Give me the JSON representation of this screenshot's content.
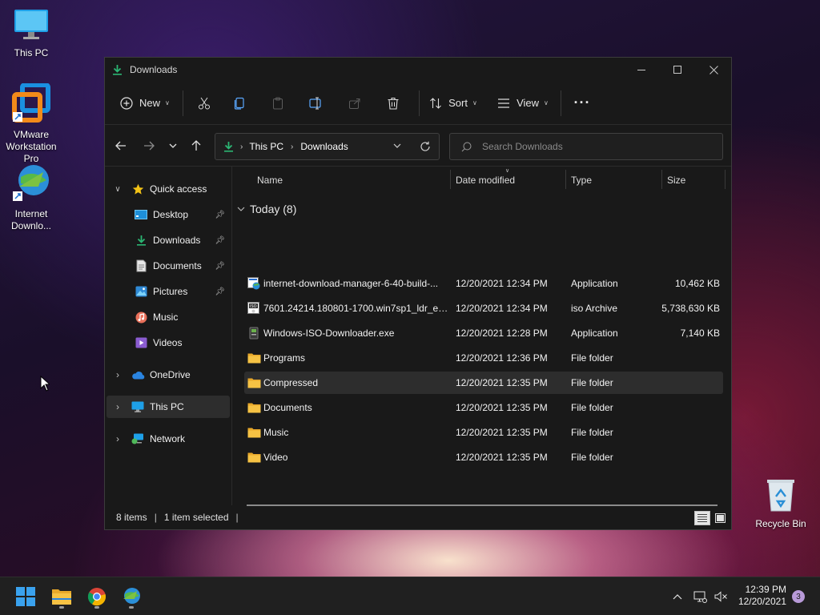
{
  "desktop": {
    "icons": [
      {
        "label": "This PC",
        "icon": "monitor-icon"
      },
      {
        "label": "VMware Workstation Pro",
        "icon": "vmware-icon"
      },
      {
        "label": "Internet Downlo...",
        "icon": "idm-globe-icon"
      },
      {
        "label": "Recycle Bin",
        "icon": "recycle-bin-icon"
      }
    ]
  },
  "window": {
    "title": "Downloads",
    "toolbar": {
      "new_label": "New",
      "sort_label": "Sort",
      "view_label": "View",
      "more_label": "···"
    },
    "address": {
      "crumbs": [
        "This PC",
        "Downloads"
      ]
    },
    "search": {
      "placeholder": "Search Downloads"
    },
    "sidebar": {
      "quick_access": "Quick access",
      "items": [
        {
          "label": "Desktop",
          "pinned": true
        },
        {
          "label": "Downloads",
          "pinned": true
        },
        {
          "label": "Documents",
          "pinned": true
        },
        {
          "label": "Pictures",
          "pinned": true
        },
        {
          "label": "Music",
          "pinned": false
        },
        {
          "label": "Videos",
          "pinned": false
        }
      ],
      "onedrive": "OneDrive",
      "this_pc": "This PC",
      "network": "Network"
    },
    "columns": {
      "name": "Name",
      "date": "Date modified",
      "type": "Type",
      "size": "Size"
    },
    "group": "Today (8)",
    "files": [
      {
        "name": "internet-download-manager-6-40-build-...",
        "date": "12/20/2021 12:34 PM",
        "type": "Application",
        "size": "10,462 KB",
        "icon": "installer-icon"
      },
      {
        "name": "7601.24214.180801-1700.win7sp1_ldr_escr...",
        "date": "12/20/2021 12:34 PM",
        "type": "iso Archive",
        "size": "5,738,630 KB",
        "icon": "iso-icon"
      },
      {
        "name": "Windows-ISO-Downloader.exe",
        "date": "12/20/2021 12:28 PM",
        "type": "Application",
        "size": "7,140 KB",
        "icon": "exe-icon"
      },
      {
        "name": "Programs",
        "date": "12/20/2021 12:36 PM",
        "type": "File folder",
        "size": "",
        "icon": "folder-icon"
      },
      {
        "name": "Compressed",
        "date": "12/20/2021 12:35 PM",
        "type": "File folder",
        "size": "",
        "icon": "folder-icon"
      },
      {
        "name": "Documents",
        "date": "12/20/2021 12:35 PM",
        "type": "File folder",
        "size": "",
        "icon": "folder-icon"
      },
      {
        "name": "Music",
        "date": "12/20/2021 12:35 PM",
        "type": "File folder",
        "size": "",
        "icon": "folder-icon"
      },
      {
        "name": "Video",
        "date": "12/20/2021 12:35 PM",
        "type": "File folder",
        "size": "",
        "icon": "folder-icon"
      }
    ],
    "status": {
      "count": "8 items",
      "selected": "1 item selected"
    }
  },
  "taskbar": {
    "time": "12:39 PM",
    "date": "12/20/2021",
    "notifications": "3"
  },
  "colors": {
    "accent_green": "#2bb673",
    "folder": "#f6c244",
    "selection": "#2d2d2d"
  }
}
